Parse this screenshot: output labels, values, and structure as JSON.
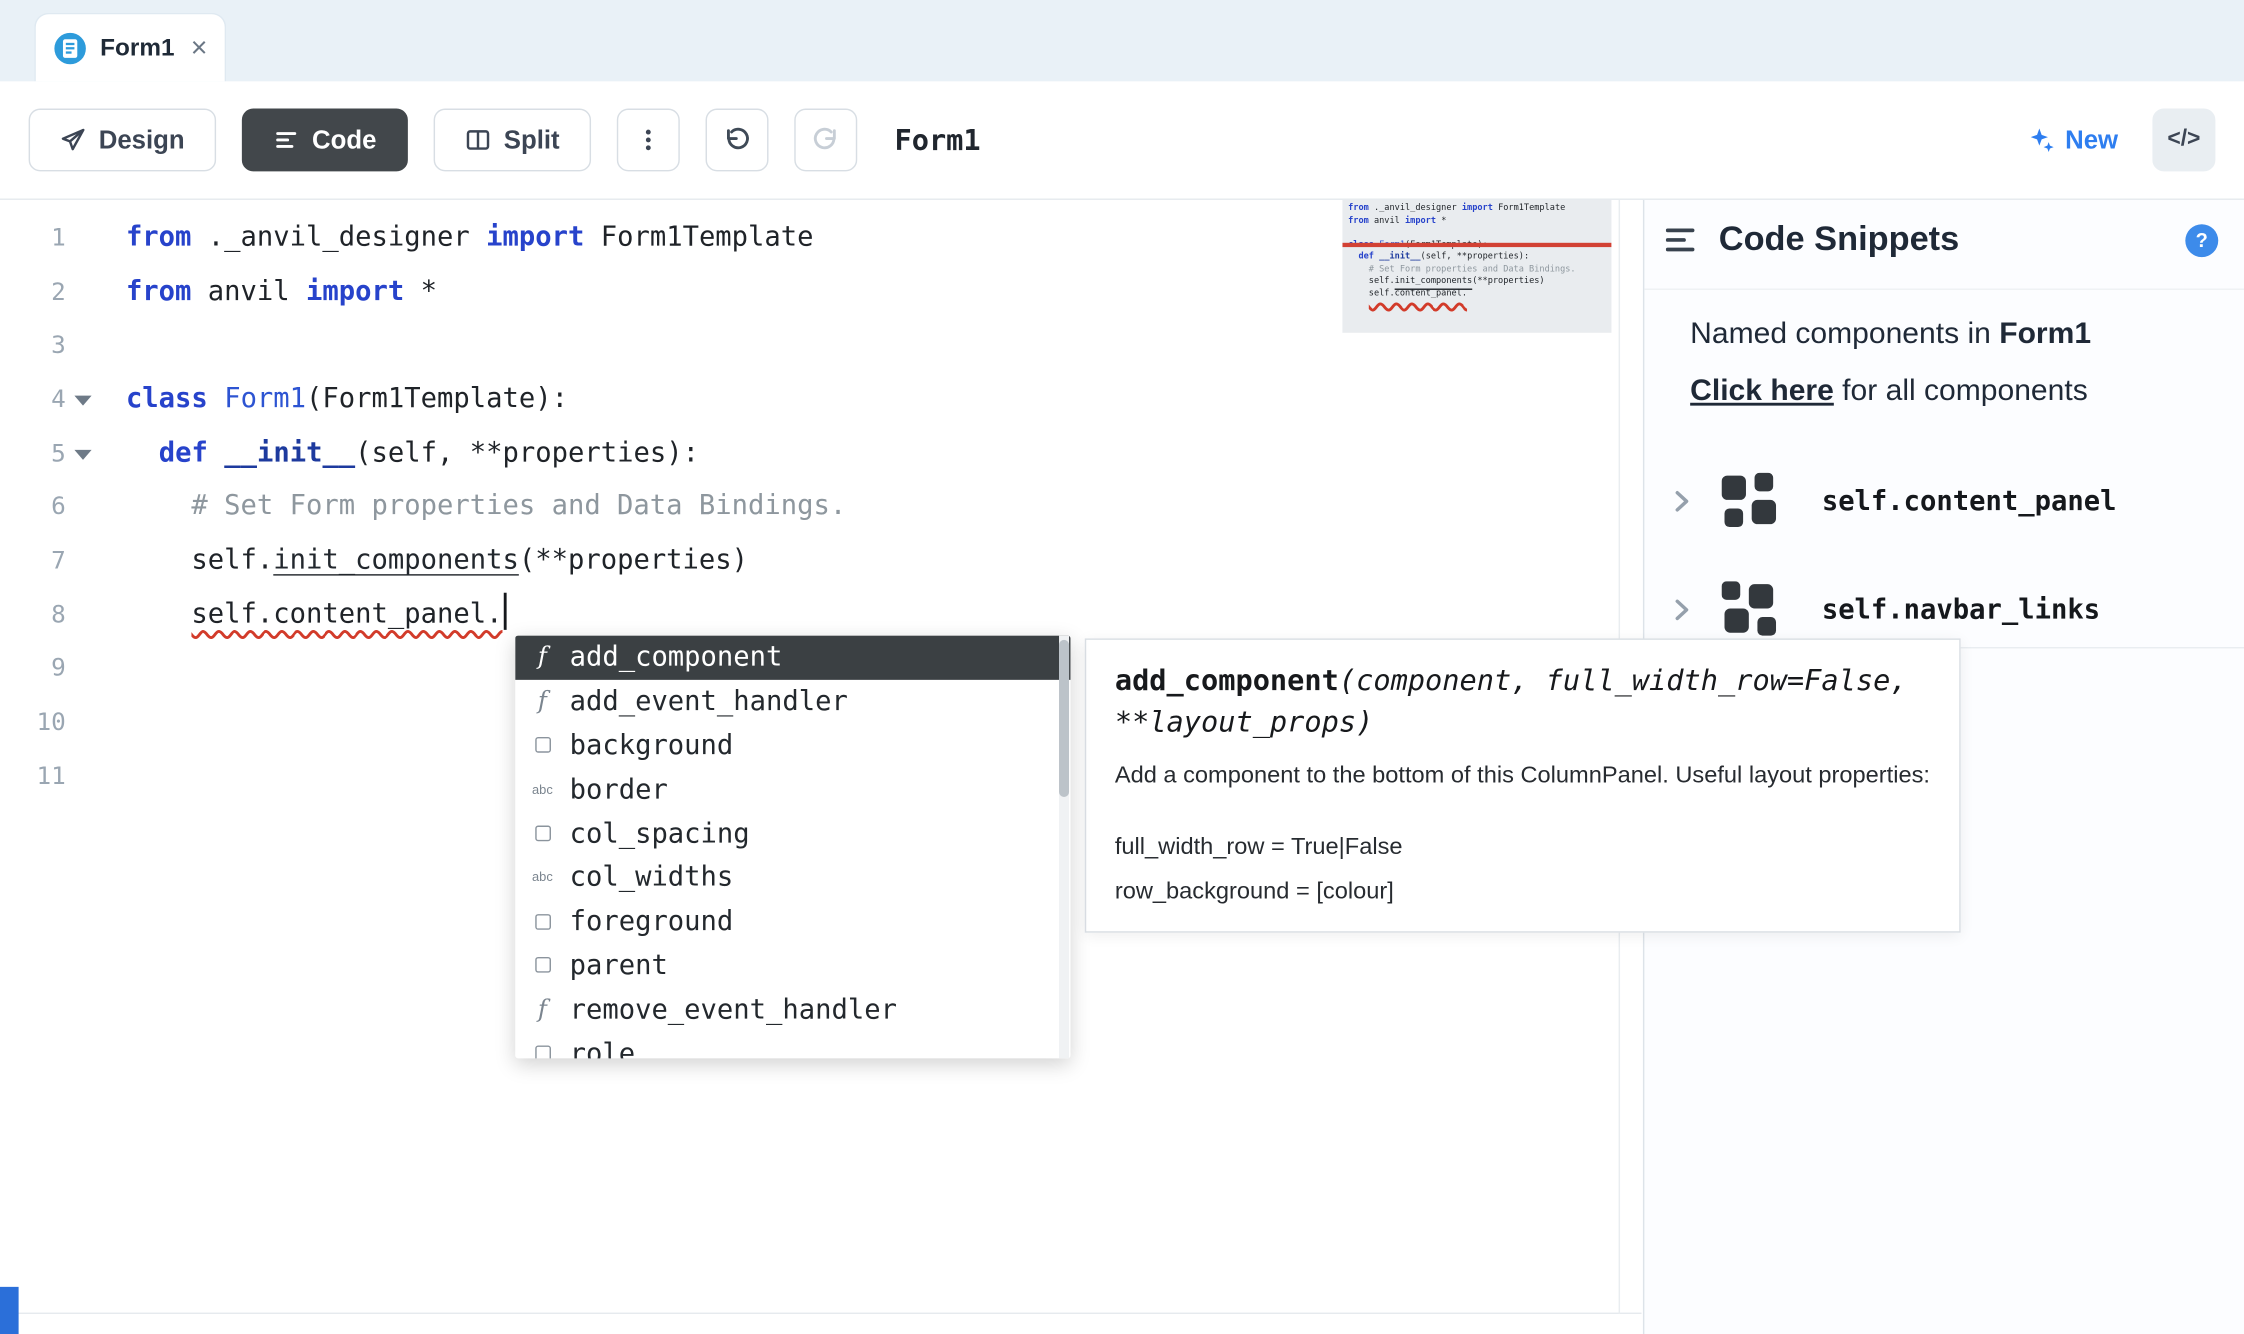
{
  "tab": {
    "title": "Form1",
    "close": "×"
  },
  "toolbar": {
    "design": "Design",
    "code": "Code",
    "split": "Split",
    "title": "Form1",
    "new": "New",
    "code_toggle": "</>"
  },
  "editor": {
    "lines": [
      {
        "num": "1",
        "tokens": [
          [
            "kw",
            "from"
          ],
          [
            "tx",
            " ._anvil_designer "
          ],
          [
            "kw",
            "import"
          ],
          [
            "tx",
            " Form1Template"
          ]
        ]
      },
      {
        "num": "2",
        "tokens": [
          [
            "kw",
            "from"
          ],
          [
            "tx",
            " anvil "
          ],
          [
            "kw",
            "import"
          ],
          [
            "tx",
            " *"
          ]
        ]
      },
      {
        "num": "3",
        "tokens": []
      },
      {
        "num": "4",
        "fold": true,
        "tokens": [
          [
            "kw",
            "class"
          ],
          [
            "tx",
            " "
          ],
          [
            "id",
            "Form1"
          ],
          [
            "tx",
            "(Form1Template):"
          ]
        ]
      },
      {
        "num": "5",
        "fold": true,
        "tokens": [
          [
            "tx",
            "  "
          ],
          [
            "kw",
            "def"
          ],
          [
            "tx",
            " "
          ],
          [
            "df",
            "__init__"
          ],
          [
            "tx",
            "(self, **properties):"
          ]
        ]
      },
      {
        "num": "6",
        "tokens": [
          [
            "cm",
            "    # Set Form properties and Data Bindings."
          ]
        ]
      },
      {
        "num": "7",
        "tokens": [
          [
            "tx",
            "    self."
          ],
          [
            "lk",
            "init_components"
          ],
          [
            "tx",
            "(**properties)"
          ]
        ]
      },
      {
        "num": "8",
        "caret": true,
        "tokens": [
          [
            "tx",
            "    "
          ],
          [
            "er",
            "self.content_panel."
          ]
        ]
      },
      {
        "num": "9",
        "tokens": []
      },
      {
        "num": "10",
        "tokens": []
      },
      {
        "num": "11",
        "tokens": []
      }
    ]
  },
  "autocomplete": {
    "items": [
      {
        "icon": "f",
        "label": "add_component",
        "selected": true
      },
      {
        "icon": "f",
        "label": "add_event_handler"
      },
      {
        "icon": "sq",
        "label": "background"
      },
      {
        "icon": "abc",
        "label": "border"
      },
      {
        "icon": "sq",
        "label": "col_spacing"
      },
      {
        "icon": "abc",
        "label": "col_widths"
      },
      {
        "icon": "sq",
        "label": "foreground"
      },
      {
        "icon": "sq",
        "label": "parent"
      },
      {
        "icon": "f",
        "label": "remove_event_handler"
      },
      {
        "icon": "sq",
        "label": "role"
      }
    ]
  },
  "doc": {
    "name": "add_component",
    "params": "(component, full_width_row=False, **layout_props)",
    "description": "Add a component to the bottom of this ColumnPanel. Useful layout properties:",
    "props": [
      "full_width_row = True|False",
      "row_background = [colour]"
    ]
  },
  "snippets": {
    "title": "Code Snippets",
    "help": "?",
    "named_prefix": "Named components in ",
    "named_form": "Form1",
    "link": "Click here",
    "link_suffix": " for all components",
    "components": [
      {
        "label": "self.content_panel"
      },
      {
        "label": "self.navbar_links"
      }
    ]
  },
  "icons": {
    "tab": "form-circle-icon",
    "design": "send-pen-icon",
    "code": "text-lines-icon",
    "split": "split-view-icon",
    "more": "kebab-menu-icon",
    "undo": "undo-arrow-icon",
    "redo": "redo-arrow-icon",
    "new": "sparkle-icon",
    "code_toggle": "code-brackets-icon",
    "snippets_menu": "hamburger-icon",
    "help": "question-circle-icon",
    "expand": "chevron-right-icon",
    "method": "f",
    "property": "square-outline",
    "text_property": "abc"
  },
  "colors": {
    "accent_blue": "#2e7ef0",
    "keyword_blue": "#2743cb",
    "error_red": "#d23b2a",
    "selected_row_bg": "#3b4043",
    "tab_icon_blue": "#2d9bdb",
    "tab_strip_bg": "#e9f1f7",
    "dark_button_bg": "#42474b"
  }
}
